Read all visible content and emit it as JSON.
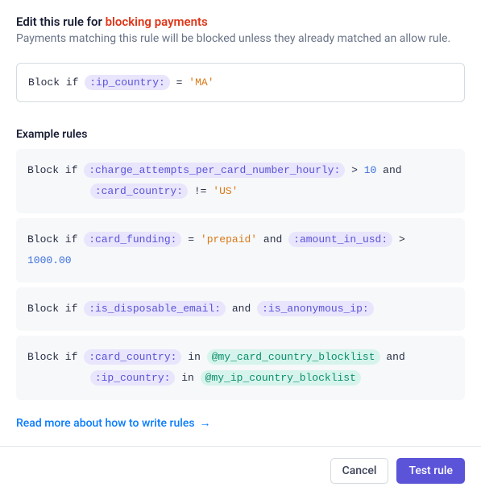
{
  "header": {
    "title_prefix": "Edit this rule for ",
    "title_highlight": "blocking payments",
    "subtitle": "Payments matching this rule will be blocked unless they already matched an allow rule."
  },
  "editor": {
    "kw_block_if": "Block if",
    "field": ":ip_country:",
    "op": "=",
    "value": "'MA'"
  },
  "examples": {
    "heading": "Example rules",
    "kw_block_if": "Block if",
    "kw_and": "and",
    "kw_in": "in",
    "rule1": {
      "field1": ":charge_attempts_per_card_number_hourly:",
      "op1": ">",
      "num1": "10",
      "field2": ":card_country:",
      "op2": "!=",
      "val2": "'US'"
    },
    "rule2": {
      "field1": ":card_funding:",
      "op1": "=",
      "val1": "'prepaid'",
      "field2": ":amount_in_usd:",
      "op2": ">",
      "num2": "1000.00"
    },
    "rule3": {
      "field1": ":is_disposable_email:",
      "field2": ":is_anonymous_ip:"
    },
    "rule4": {
      "field1": ":card_country:",
      "list1": "@my_card_country_blocklist",
      "field2": ":ip_country:",
      "list2": "@my_ip_country_blocklist"
    }
  },
  "link": {
    "text": "Read more about how to write rules",
    "arrow": "→"
  },
  "footer": {
    "cancel": "Cancel",
    "test": "Test rule"
  }
}
